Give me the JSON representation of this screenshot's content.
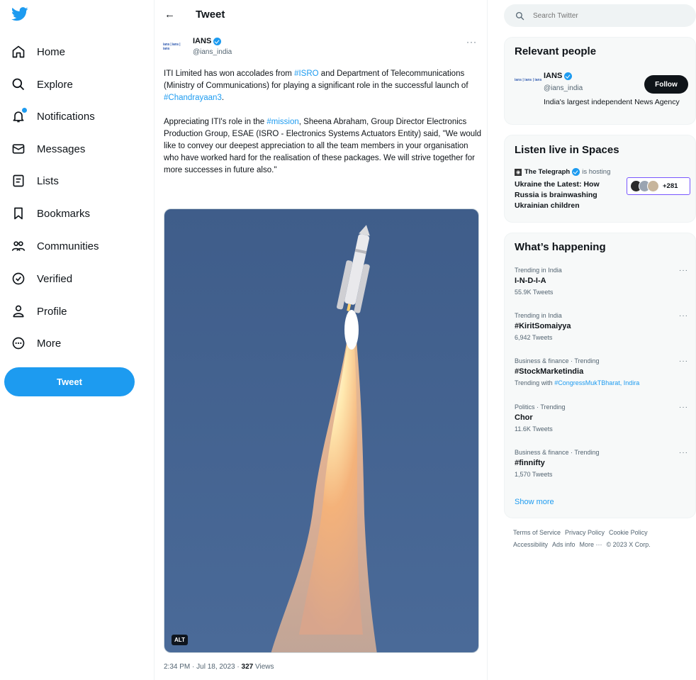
{
  "nav": {
    "items": [
      {
        "label": "Home",
        "icon": "home-icon"
      },
      {
        "label": "Explore",
        "icon": "search-icon"
      },
      {
        "label": "Notifications",
        "icon": "bell-icon"
      },
      {
        "label": "Messages",
        "icon": "envelope-icon"
      },
      {
        "label": "Lists",
        "icon": "list-icon"
      },
      {
        "label": "Bookmarks",
        "icon": "bookmark-icon"
      },
      {
        "label": "Communities",
        "icon": "people-icon"
      },
      {
        "label": "Verified",
        "icon": "verified-icon"
      },
      {
        "label": "Profile",
        "icon": "person-icon"
      },
      {
        "label": "More",
        "icon": "more-circle-icon"
      }
    ],
    "tweet_button": "Tweet"
  },
  "header": {
    "title": "Tweet"
  },
  "tweet": {
    "author_name": "IANS",
    "author_handle": "@ians_india",
    "avatar_text": "ians | ians | ians",
    "more": "···",
    "paragraphs": [
      {
        "segments": [
          {
            "text": "ITI Limited has won accolades from ",
            "link": false
          },
          {
            "text": "#ISRO",
            "link": true
          },
          {
            "text": " and Department of Telecommunications (Ministry of Communications) for playing a significant role in the successful launch of ",
            "link": false
          },
          {
            "text": "#Chandrayaan3",
            "link": true
          },
          {
            "text": ".",
            "link": false
          }
        ]
      },
      {
        "segments": [
          {
            "text": "Appreciating ITI's role in the ",
            "link": false
          },
          {
            "text": "#mission",
            "link": true
          },
          {
            "text": ",  Sheena Abraham, Group Director Electronics Production Group, ESAE (ISRO - Electronics Systems Actuators Entity) said, \"We would like to convey our deepest appreciation to all the team members in your organisation who have worked hard for the realisation of these packages. We will strive together for more successes in future also.\"",
            "link": false
          }
        ]
      }
    ],
    "alt_badge": "ALT",
    "timestamp": "2:34 PM · Jul 18, 2023 · ",
    "views_count": "327",
    "views_label": " Views"
  },
  "search": {
    "placeholder": "Search Twitter"
  },
  "relevant": {
    "title": "Relevant people",
    "name": "IANS",
    "handle": "@ians_india",
    "bio": "India's largest independent News Agency",
    "follow": "Follow"
  },
  "spaces": {
    "title": "Listen live in Spaces",
    "host": "The Telegraph",
    "hosting": "is hosting",
    "space_title": "Ukraine the Latest: How Russia is brainwashing Ukrainian children",
    "listeners": "+281"
  },
  "happening": {
    "title": "What’s happening",
    "trends": [
      {
        "meta": "Trending in India",
        "name": "I-N-D-I-A",
        "count": "55.9K Tweets"
      },
      {
        "meta": "Trending in India",
        "name": "#KiritSomaiyya",
        "count": "6,942 Tweets"
      },
      {
        "meta": "Business & finance · Trending",
        "name": "#StockMarketindia",
        "count_prefix": "Trending with ",
        "count_links": "#CongressMukTBharat, Indira"
      },
      {
        "meta": "Politics · Trending",
        "name": "Chor",
        "count": "11.6K Tweets"
      },
      {
        "meta": "Business & finance · Trending",
        "name": "#finnifty",
        "count": "1,570 Tweets"
      }
    ],
    "show_more": "Show more"
  },
  "footer": {
    "links": [
      "Terms of Service",
      "Privacy Policy",
      "Cookie Policy",
      "Accessibility",
      "Ads info",
      "More ···",
      "© 2023 X Corp."
    ]
  },
  "colors": {
    "accent": "#1d9bf0",
    "text": "#0f1419",
    "muted": "#536471",
    "card": "#f7f9f9"
  }
}
